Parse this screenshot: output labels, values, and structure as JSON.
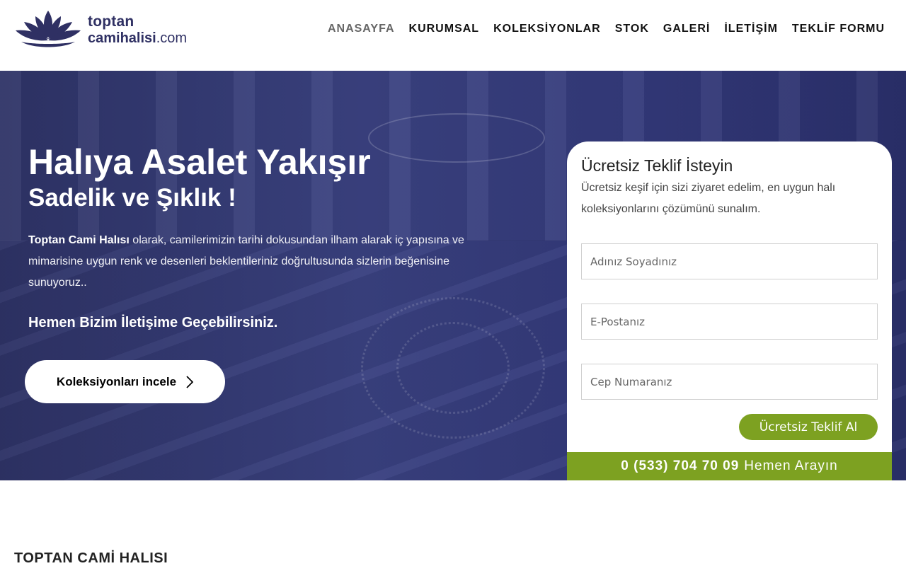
{
  "logo": {
    "line1": "toptan",
    "line2_bold": "camihalisi",
    "line2_domain": ".com"
  },
  "nav": {
    "items": [
      "ANASAYFA",
      "KURUMSAL",
      "KOLEKSİYONLAR",
      "STOK",
      "GALERİ",
      "İLETİŞİM",
      "TEKLİF FORMU"
    ],
    "active": "ANASAYFA"
  },
  "hero": {
    "title": "Halıya Asalet Yakışır",
    "subtitle": "Sadelik ve Şıklık !",
    "text_bold": "Toptan Cami Halısı",
    "text_rest": " olarak, camilerimizin tarihi dokusundan ilham alarak iç yapısına ve mimarisine uygun renk ve desenleri beklentileriniz doğrultusunda sizlerin beğenisine sunuyoruz..",
    "cta_text": "Hemen Bizim İletişime Geçebilirsiniz.",
    "button_label": "Koleksiyonları incele"
  },
  "form": {
    "title": "Ücretsiz Teklif İsteyin",
    "description": "Ücretsiz keşif için sizi ziyaret edelim, en uygun halı koleksiyonlarını çözümünü sunalım.",
    "name_placeholder": "Adınız Soyadınız",
    "email_placeholder": "E-Postanız",
    "phone_placeholder": "Cep Numaranız",
    "submit_label": "Ücretsiz Teklif Al",
    "phone_number": "0 (533) 704 70 09",
    "phone_suffix": "Hemen Arayın"
  },
  "section": {
    "title": "TOPTAN CAMİ HALISI"
  },
  "colors": {
    "brand_navy": "#2f3063",
    "accent_green": "#7da121",
    "hero_overlay": "#33397a"
  }
}
